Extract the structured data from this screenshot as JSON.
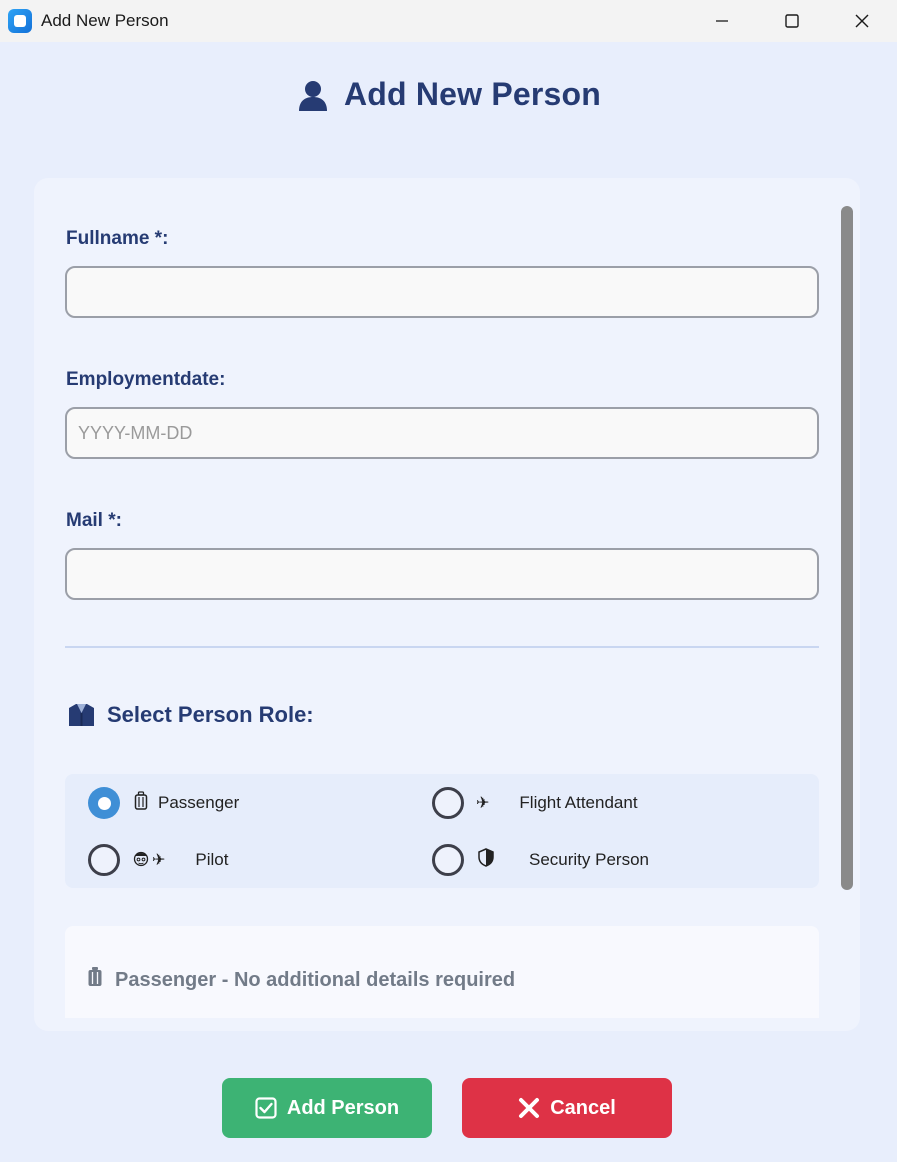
{
  "window": {
    "title": "Add New Person",
    "controls": [
      "minimize",
      "maximize",
      "close"
    ]
  },
  "header": {
    "icon": "person-icon",
    "title": "Add New Person"
  },
  "form": {
    "fullname": {
      "label": "Fullname *:",
      "value": "",
      "placeholder": ""
    },
    "employment_date": {
      "label": "Employmentdate:",
      "value": "",
      "placeholder": "YYYY-MM-DD"
    },
    "mail": {
      "label": "Mail *:",
      "value": "",
      "placeholder": ""
    }
  },
  "role_section": {
    "icon": "uniform-icon",
    "title": "Select Person Role:",
    "roles": [
      {
        "label": "Passenger",
        "icon": "luggage-icon",
        "selected": true
      },
      {
        "label": "Flight Attendant",
        "icon": "airplane-icon",
        "selected": false
      },
      {
        "label": "Pilot",
        "icon": "pilot-icon",
        "selected": false
      },
      {
        "label": "Security Person",
        "icon": "shield-icon",
        "selected": false
      }
    ]
  },
  "details": {
    "icon": "luggage-icon",
    "message": "Passenger - No additional details required"
  },
  "buttons": {
    "add": "Add Person",
    "cancel": "Cancel"
  },
  "colors": {
    "accent": "#263b73",
    "add": "#3db374",
    "cancel": "#de3246",
    "radio_selected": "#3f8fd6"
  }
}
